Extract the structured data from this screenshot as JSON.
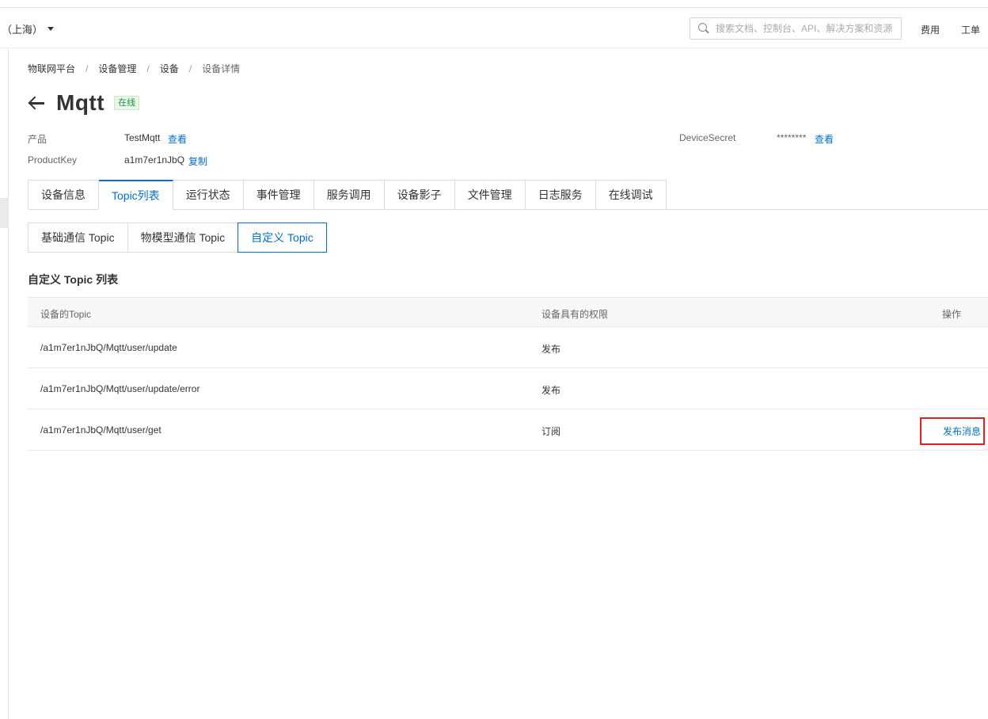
{
  "topbar": {
    "region": "（上海）",
    "search_placeholder": "搜索文档、控制台、API、解决方案和资源",
    "links": [
      "费用",
      "工单"
    ]
  },
  "breadcrumb": [
    "物联网平台",
    "设备管理",
    "设备",
    "设备详情"
  ],
  "header": {
    "title": "Mqtt",
    "status": "在线"
  },
  "info": {
    "product_label": "产品",
    "product_value": "TestMqtt",
    "product_link": "查看",
    "productkey_label": "ProductKey",
    "productkey_value": "a1m7er1nJbQ",
    "productkey_link": "复制",
    "devicesecret_label": "DeviceSecret",
    "devicesecret_value": "********",
    "devicesecret_link": "查看"
  },
  "tabs": [
    "设备信息",
    "Topic列表",
    "运行状态",
    "事件管理",
    "服务调用",
    "设备影子",
    "文件管理",
    "日志服务",
    "在线调试"
  ],
  "subtabs": [
    "基础通信 Topic",
    "物模型通信 Topic",
    "自定义 Topic"
  ],
  "section_title": "自定义 Topic 列表",
  "table": {
    "columns": [
      "设备的Topic",
      "设备具有的权限",
      "操作"
    ],
    "rows": [
      {
        "topic": "/a1m7er1nJbQ/Mqtt/user/update",
        "permission": "发布",
        "action": ""
      },
      {
        "topic": "/a1m7er1nJbQ/Mqtt/user/update/error",
        "permission": "发布",
        "action": ""
      },
      {
        "topic": "/a1m7er1nJbQ/Mqtt/user/get",
        "permission": "订阅",
        "action": "发布消息"
      }
    ]
  },
  "colors": {
    "accent": "#0070cc",
    "status_green": "#1e8e3e",
    "highlight_red": "#e02020"
  }
}
